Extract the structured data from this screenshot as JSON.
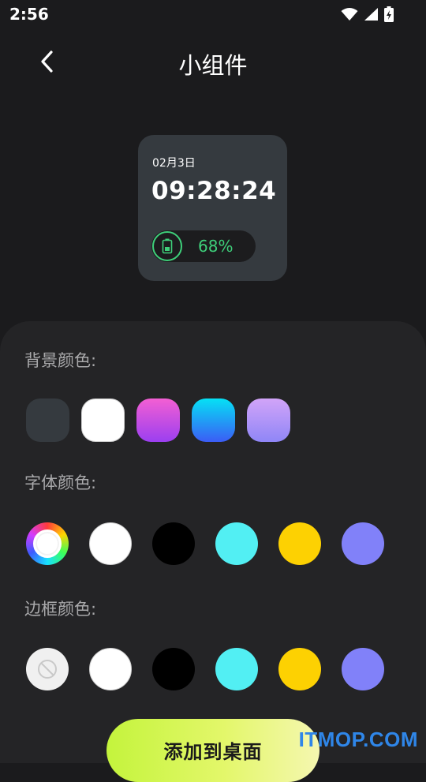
{
  "status_bar": {
    "time": "2:56",
    "icons": [
      "wifi-icon",
      "signal-icon",
      "battery-charging-icon"
    ]
  },
  "app_bar": {
    "title": "小组件",
    "back_icon": "chevron-left-icon"
  },
  "widget": {
    "date": "02月3日",
    "time": "09:28:24",
    "battery_percent": "68%",
    "background": "#353a3f",
    "battery_color": "#3ecf7a"
  },
  "background_color": {
    "label": "背景颜色:",
    "options": [
      {
        "name": "dark-gray",
        "fill": "#353a3f"
      },
      {
        "name": "white",
        "fill": "#ffffff"
      },
      {
        "name": "pink-purple-gradient",
        "fill": "linear-gradient(180deg,#f35fd3,#9b3ff0)"
      },
      {
        "name": "cyan-blue-gradient",
        "fill": "linear-gradient(180deg,#05e1f5,#3b5cf5)"
      },
      {
        "name": "lavender-gradient",
        "fill": "linear-gradient(180deg,#d2a4f8,#8f86f7)"
      }
    ]
  },
  "font_color": {
    "label": "字体颜色:",
    "options": [
      {
        "name": "color-wheel",
        "fill": "rainbow"
      },
      {
        "name": "white",
        "fill": "#ffffff"
      },
      {
        "name": "black",
        "fill": "#000000"
      },
      {
        "name": "cyan",
        "fill": "#52eff3"
      },
      {
        "name": "yellow",
        "fill": "#fdd102"
      },
      {
        "name": "periwinkle",
        "fill": "#8181f9"
      }
    ]
  },
  "border_color": {
    "label": "边框颜色:",
    "options": [
      {
        "name": "none",
        "fill": "#f0f0f0",
        "icon": "no-symbol-icon"
      },
      {
        "name": "white",
        "fill": "#ffffff"
      },
      {
        "name": "black",
        "fill": "#000000"
      },
      {
        "name": "cyan",
        "fill": "#52eff3"
      },
      {
        "name": "yellow",
        "fill": "#fdd102"
      },
      {
        "name": "periwinkle",
        "fill": "#8181f9"
      }
    ]
  },
  "add_button": {
    "label": "添加到桌面"
  },
  "watermark": "ITMOP.COM"
}
